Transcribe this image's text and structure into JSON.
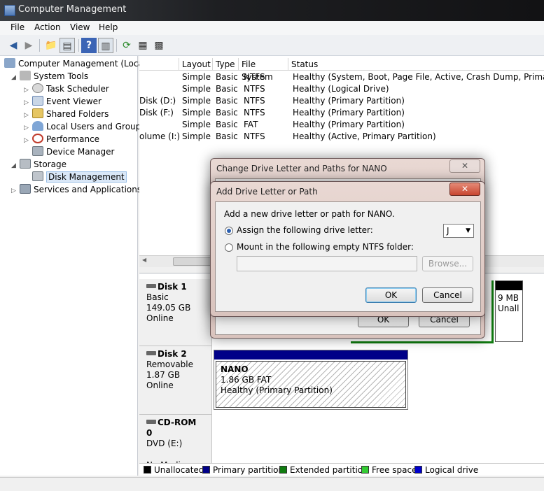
{
  "window": {
    "title": "Computer Management"
  },
  "menu": [
    "File",
    "Action",
    "View",
    "Help"
  ],
  "tree": {
    "root": "Computer Management (Local",
    "system_tools": "System Tools",
    "task_scheduler": "Task Scheduler",
    "event_viewer": "Event Viewer",
    "shared_folders": "Shared Folders",
    "local_users": "Local Users and Groups",
    "performance": "Performance",
    "device_manager": "Device Manager",
    "storage": "Storage",
    "disk_management": "Disk Management",
    "services": "Services and Applications"
  },
  "volumes": {
    "headers": [
      "Layout",
      "Type",
      "File System",
      "Status"
    ],
    "rows": [
      {
        "volume": "",
        "layout": "Simple",
        "type": "Basic",
        "fs": "NTFS",
        "status": "Healthy (System, Boot, Page File, Active, Crash Dump, Primary Partitio"
      },
      {
        "volume": "",
        "layout": "Simple",
        "type": "Basic",
        "fs": "NTFS",
        "status": "Healthy (Logical Drive)"
      },
      {
        "volume": "Disk (D:)",
        "layout": "Simple",
        "type": "Basic",
        "fs": "NTFS",
        "status": "Healthy (Primary Partition)"
      },
      {
        "volume": "Disk (F:)",
        "layout": "Simple",
        "type": "Basic",
        "fs": "NTFS",
        "status": "Healthy (Primary Partition)"
      },
      {
        "volume": "",
        "layout": "Simple",
        "type": "Basic",
        "fs": "FAT",
        "status": "Healthy (Primary Partition)"
      },
      {
        "volume": "olume (I:)",
        "layout": "Simple",
        "type": "Basic",
        "fs": "NTFS",
        "status": "Healthy (Active, Primary Partition)"
      }
    ]
  },
  "disks": {
    "disk1": {
      "name": "Disk 1",
      "type": "Basic",
      "size": "149.05 GB",
      "state": "Online",
      "unalloc_size": "9 MB",
      "unalloc_label": "Unall"
    },
    "disk2": {
      "name": "Disk 2",
      "type": "Removable",
      "size": "1.87 GB",
      "state": "Online",
      "partition": {
        "name": "NANO",
        "size_fs": "1.86 GB FAT",
        "status": "Healthy (Primary Partition)"
      }
    },
    "cdrom": {
      "name": "CD-ROM 0",
      "type": "DVD (E:)",
      "state": "No Media"
    }
  },
  "legend": [
    {
      "label": "Unallocated",
      "color": "#000000"
    },
    {
      "label": "Primary partition",
      "color": "#000088"
    },
    {
      "label": "Extended partition",
      "color": "#107c10"
    },
    {
      "label": "Free space",
      "color": "#33cc33"
    },
    {
      "label": "Logical drive",
      "color": "#0000cc"
    }
  ],
  "dialog_back": {
    "title": "Change Drive Letter and Paths for NANO",
    "ok": "OK",
    "cancel": "Cancel"
  },
  "dialog_front": {
    "title": "Add Drive Letter or Path",
    "intro": "Add a new drive letter or path for NANO.",
    "assign_label": "Assign the following drive letter:",
    "drive_letter": "J",
    "mount_label": "Mount in the following empty NTFS folder:",
    "folder_path": "",
    "browse": "Browse...",
    "ok": "OK",
    "cancel": "Cancel"
  },
  "colors": {
    "primary": "#000088",
    "extended": "#107c10",
    "close_button": "#c8452f"
  }
}
